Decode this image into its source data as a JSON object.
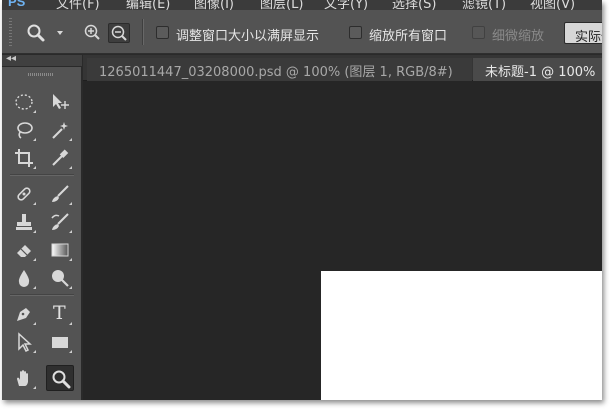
{
  "app": {
    "logo": "PS",
    "menu": [
      "文件(F)",
      "编辑(E)",
      "图像(I)",
      "图层(L)",
      "文字(Y)",
      "选择(S)",
      "滤镜(T)",
      "视图(V)"
    ]
  },
  "options_bar": {
    "tool_preset_icon": "zoom-tool-icon",
    "zoom_in_icon": "zoom-in-icon",
    "zoom_out_icon": "zoom-out-icon",
    "resize_windows_label": "调整窗口大小以满屏显示",
    "zoom_all_windows_label": "缩放所有窗口",
    "scrubby_zoom_label": "细微缩放",
    "actual_pixels_label": "实际像素",
    "resize_windows_checked": false,
    "zoom_all_windows_checked": false,
    "scrubby_zoom_enabled": false
  },
  "toolbox": {
    "collapse_glyph": "◂◂",
    "tools": [
      "elliptical-marquee-icon",
      "move-tool-icon",
      "lasso-icon",
      "magic-wand-icon",
      "crop-icon",
      "eyedropper-icon",
      "healing-brush-icon",
      "brush-icon",
      "clone-stamp-icon",
      "history-brush-icon",
      "eraser-icon",
      "gradient-icon",
      "blur-icon",
      "dodge-icon",
      "pen-icon",
      "type-icon",
      "path-selection-icon",
      "rectangle-icon",
      "hand-icon",
      "zoom-tool-icon"
    ],
    "active_tool": "zoom-tool-icon",
    "type_tool_glyph": "T"
  },
  "tabs": [
    {
      "label": "1265011447_03208000.psd @ 100% (图层 1, RGB/8#)",
      "active": false,
      "close": "×"
    },
    {
      "label": "未标题-1 @ 100%",
      "active": true
    }
  ],
  "colors": {
    "panel": "#535353",
    "workspace": "#262626",
    "document": "#ffffff"
  }
}
